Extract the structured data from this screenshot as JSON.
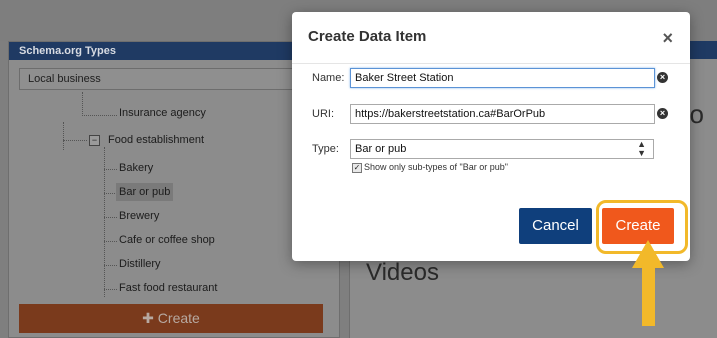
{
  "background": {
    "left_panel": {
      "header": "Schema.org Types",
      "select_value": "Local business",
      "tree_items": [
        "Insurance agency",
        "Food establishment",
        "Bakery",
        "Bar or pub",
        "Brewery",
        "Cafe or coffee shop",
        "Distillery",
        "Fast food restaurant"
      ],
      "create_button": "Create"
    },
    "right_panel": {
      "partial_char": "o",
      "section_title": "Videos"
    }
  },
  "modal": {
    "title": "Create Data Item",
    "close_label": "×",
    "name_label": "Name:",
    "name_value": "Baker Street Station",
    "uri_label": "URI:",
    "uri_value": "https://bakerstreetstation.ca#BarOrPub",
    "type_label": "Type:",
    "type_value": "Bar or pub",
    "subtypes_checked": true,
    "subtypes_label": "Show only sub-types of \"Bar or pub\"",
    "cancel_label": "Cancel",
    "create_label": "Create"
  },
  "colors": {
    "create_orange": "#f0581c",
    "cancel_blue": "#0f3f7c",
    "highlight_gold": "#f2b92a"
  }
}
